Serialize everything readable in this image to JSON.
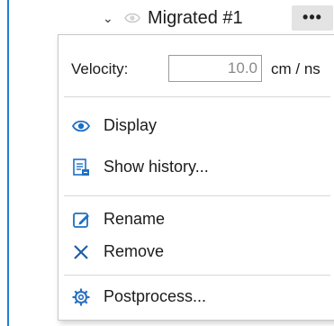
{
  "tree": {
    "node_title": "Migrated #1",
    "more_label": "•••",
    "expand_icon": "chevron-down-icon",
    "visibility_icon": "eye-icon"
  },
  "menu": {
    "velocity": {
      "label": "Velocity:",
      "value": "10.0",
      "unit": "cm / ns"
    },
    "items": [
      {
        "label": "Display",
        "icon": "eye-icon"
      },
      {
        "label": "Show history...",
        "icon": "history-icon"
      },
      {
        "label": "Rename",
        "icon": "rename-icon"
      },
      {
        "label": "Remove",
        "icon": "remove-icon"
      },
      {
        "label": "Postprocess...",
        "icon": "gear-icon"
      }
    ]
  },
  "colors": {
    "accent": "#1f7fd6",
    "rename_icon": "#1e6fc2",
    "remove_icon": "#1e5ea8",
    "gear_icon": "#2a6fbf"
  }
}
